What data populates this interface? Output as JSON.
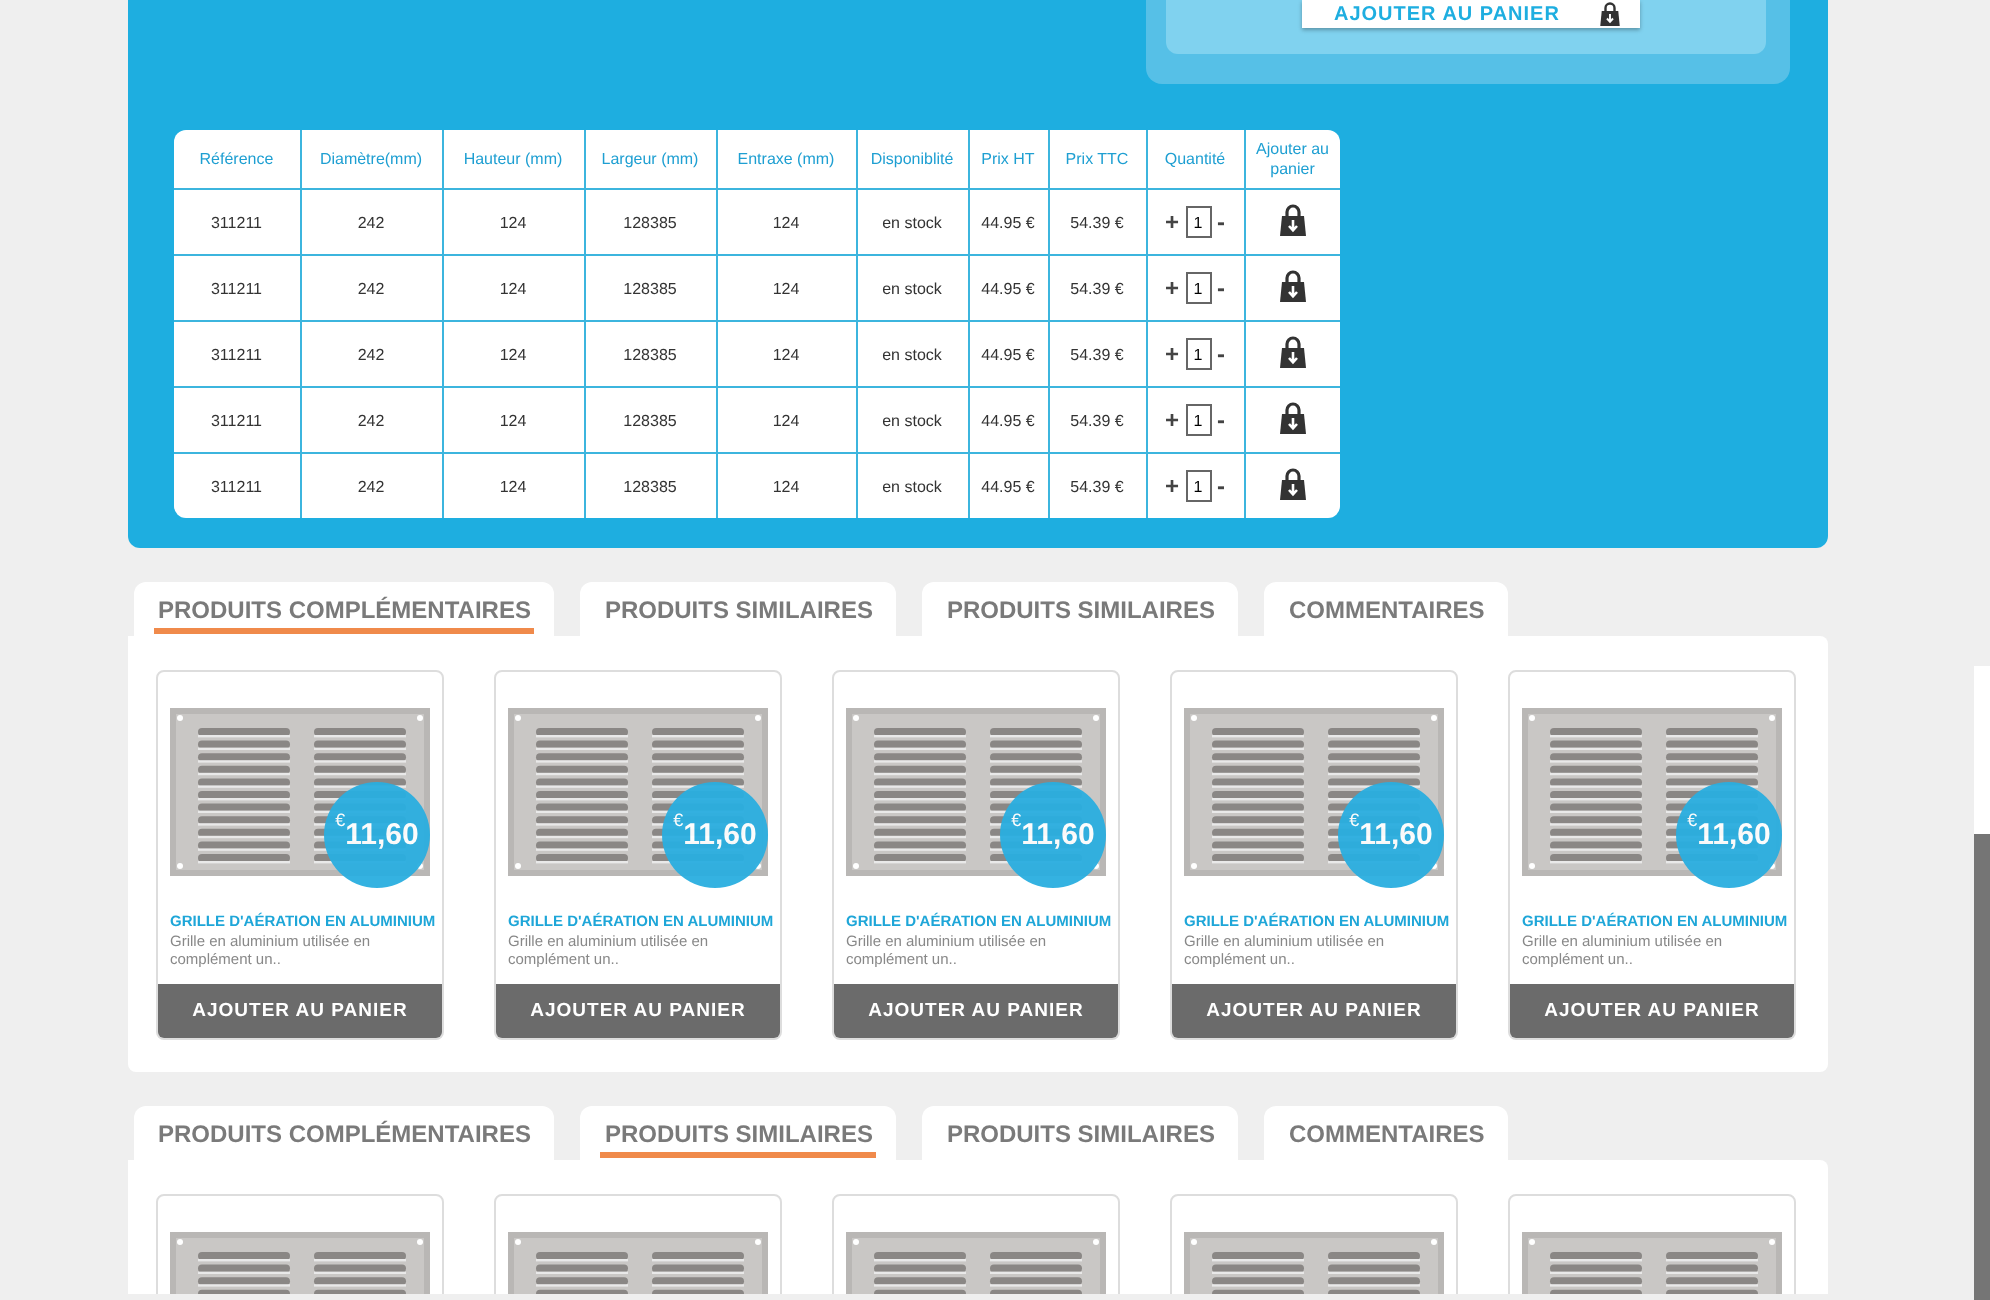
{
  "top_panel": {
    "add_to_cart_button": "AJOUTER AU PANIER"
  },
  "table": {
    "columns": [
      "Référence",
      "Diamètre(mm)",
      "Hauteur (mm)",
      "Largeur (mm)",
      "Entraxe (mm)",
      "Disponiblité",
      "Prix HT",
      "Prix TTC",
      "Quantité",
      "Ajouter au panier"
    ],
    "rows": [
      {
        "reference": "311211",
        "diametre": "242",
        "hauteur": "124",
        "largeur": "128385",
        "entraxe": "124",
        "disponibilite": "en stock",
        "prix_ht": "44.95 €",
        "prix_ttc": "54.39 €",
        "plus": "+",
        "quantity": "1",
        "minus": "-"
      },
      {
        "reference": "311211",
        "diametre": "242",
        "hauteur": "124",
        "largeur": "128385",
        "entraxe": "124",
        "disponibilite": "en stock",
        "prix_ht": "44.95 €",
        "prix_ttc": "54.39 €",
        "plus": "+",
        "quantity": "1",
        "minus": "-"
      },
      {
        "reference": "311211",
        "diametre": "242",
        "hauteur": "124",
        "largeur": "128385",
        "entraxe": "124",
        "disponibilite": "en stock",
        "prix_ht": "44.95 €",
        "prix_ttc": "54.39 €",
        "plus": "+",
        "quantity": "1",
        "minus": "-"
      },
      {
        "reference": "311211",
        "diametre": "242",
        "hauteur": "124",
        "largeur": "128385",
        "entraxe": "124",
        "disponibilite": "en stock",
        "prix_ht": "44.95 €",
        "prix_ttc": "54.39 €",
        "plus": "+",
        "quantity": "1",
        "minus": "-"
      },
      {
        "reference": "311211",
        "diametre": "242",
        "hauteur": "124",
        "largeur": "128385",
        "entraxe": "124",
        "disponibilite": "en stock",
        "prix_ht": "44.95 €",
        "prix_ttc": "54.39 €",
        "plus": "+",
        "quantity": "1",
        "minus": "-"
      }
    ]
  },
  "sections": [
    {
      "tabs": [
        {
          "label": "PRODUITS COMPLÉMENTAIRES",
          "selected": true
        },
        {
          "label": "PRODUITS SIMILAIRES",
          "selected": false
        },
        {
          "label": "PRODUITS SIMILAIRES",
          "selected": false
        },
        {
          "label": "COMMENTAIRES",
          "selected": false
        }
      ],
      "products": [
        {
          "kind": "full",
          "currency": "€",
          "price": "11,60",
          "title": "GRILLE D'AÉRATION EN ALUMINIUM",
          "description": "Grille en aluminium utilisée en complément un..",
          "button": "AJOUTER AU PANIER"
        },
        {
          "kind": "full",
          "currency": "€",
          "price": "11,60",
          "title": "GRILLE D'AÉRATION EN ALUMINIUM",
          "description": "Grille en aluminium utilisée en complément un..",
          "button": "AJOUTER AU PANIER"
        },
        {
          "kind": "full",
          "currency": "€",
          "price": "11,60",
          "title": "GRILLE D'AÉRATION EN ALUMINIUM",
          "description": "Grille en aluminium utilisée en complément un..",
          "button": "AJOUTER AU PANIER"
        },
        {
          "kind": "full",
          "currency": "€",
          "price": "11,60",
          "title": "GRILLE D'AÉRATION EN ALUMINIUM",
          "description": "Grille en aluminium utilisée en complément un..",
          "button": "AJOUTER AU PANIER"
        },
        {
          "kind": "full",
          "currency": "€",
          "price": "11,60",
          "title": "GRILLE D'AÉRATION EN ALUMINIUM",
          "description": "Grille en aluminium utilisée en complément un..",
          "button": "AJOUTER AU PANIER"
        }
      ]
    },
    {
      "tabs": [
        {
          "label": "PRODUITS COMPLÉMENTAIRES",
          "selected": false
        },
        {
          "label": "PRODUITS SIMILAIRES",
          "selected": true
        },
        {
          "label": "PRODUITS SIMILAIRES",
          "selected": false
        },
        {
          "label": "COMMENTAIRES",
          "selected": false
        }
      ],
      "products": [
        {
          "kind": "image_only"
        },
        {
          "kind": "image_only"
        },
        {
          "kind": "image_only"
        },
        {
          "kind": "image_only"
        },
        {
          "kind": "image_only"
        }
      ]
    }
  ]
}
